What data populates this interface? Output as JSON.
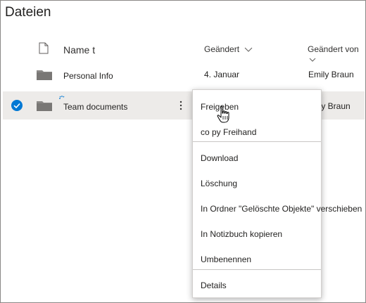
{
  "header": {
    "title": "Dateien"
  },
  "columns": {
    "name": "Name t",
    "modified": "Geändert",
    "modified_by": "Geändert von"
  },
  "rows": [
    {
      "name": "Personal Info",
      "modified": "4. Januar",
      "modified_by": "Emily Braun",
      "selected": false
    },
    {
      "name": "Team documents",
      "modified": "",
      "modified_by": "ily Braun",
      "selected": true
    }
  ],
  "row_actions_icon": "more-vertical-icon",
  "context_menu": {
    "items": [
      "Freigeben",
      "co py Freihand",
      "Download",
      "Löschung",
      "In Ordner \"Gelöschte Objekte\" verschieben",
      "In Notizbuch kopieren",
      "Umbenennen",
      "Details"
    ]
  },
  "colors": {
    "accent": "#0078d4",
    "selected_row": "#edebe9"
  }
}
